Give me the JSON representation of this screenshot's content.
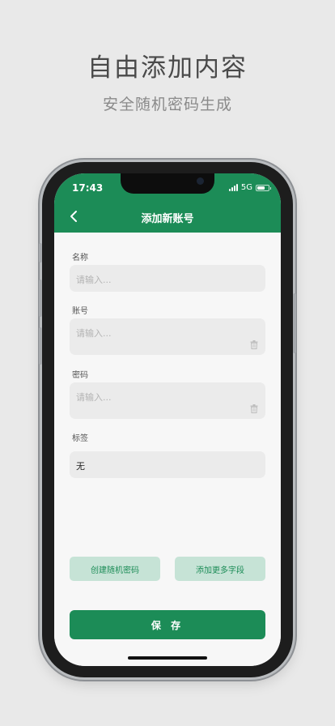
{
  "promo": {
    "headline": "自由添加内容",
    "subheadline": "安全随机密码生成"
  },
  "status_bar": {
    "time": "17:43",
    "network": "5G"
  },
  "nav": {
    "title": "添加新账号"
  },
  "form": {
    "fields": [
      {
        "label": "名称",
        "placeholder": "请输入..."
      },
      {
        "label": "账号",
        "placeholder": "请输入..."
      },
      {
        "label": "密码",
        "placeholder": "请输入..."
      },
      {
        "label": "标签",
        "value": "无"
      }
    ]
  },
  "actions": {
    "random_password": "创建随机密码",
    "add_field": "添加更多字段",
    "save": "保 存"
  },
  "colors": {
    "primary": "#1c8c57",
    "secondary_button": "#c6e3d6",
    "background": "#e9e9e9",
    "input_background": "#ebebeb"
  }
}
